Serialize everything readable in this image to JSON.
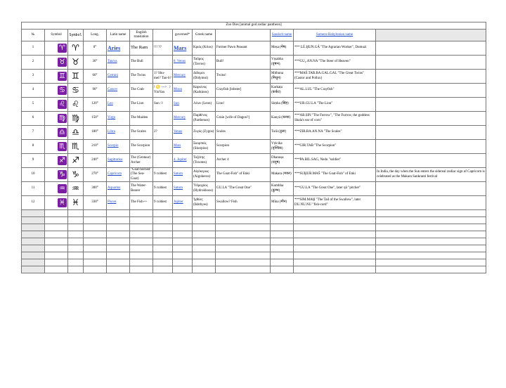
{
  "title": "Zoo Dies [animal god zodiac pantheon]",
  "headers": {
    "n": "№",
    "symbol": "Symbol",
    "symbol2": "Symbol",
    "long": "Long.",
    "latin": "Latin name",
    "english": "English translation",
    "extra": "",
    "governed": "governed*",
    "greek": "Greek name",
    "greek_tr": "",
    "sanskrit": "Sanskrit name",
    "sumero": "Sumero-Babylonian name",
    "notes": ""
  },
  "rows": [
    {
      "n": "1",
      "icon": "♈",
      "sym": "♈",
      "long": "0°",
      "latin": "Aries",
      "en": "The Ram",
      "extra": "!!! ??",
      "gov": "Mars",
      "greek": "Κριός (Krios)",
      "greek_tr": "Former Pawn Peasant",
      "skt": "Meṣa (मेष)",
      "sumer": "*** LÚ.ḪUN.GÁ \"The Agrarian Worker\", Dumuzi",
      "notes": ""
    },
    {
      "n": "2",
      "icon": "♉",
      "sym": "♉",
      "long": "30°",
      "latin": "Taurus",
      "en": "The Bull",
      "extra": "",
      "gov": "8. Venus",
      "greek": "Ταῦρος (Tavros)",
      "greek_tr": "Bull!",
      "skt": "Vṛṣabha (वृषभ)",
      "sumer": "***GU₄.AN.NA \"The Steer of Heaven\"",
      "notes": ""
    },
    {
      "n": "3",
      "icon": "♊",
      "sym": "♊",
      "long": "60°",
      "latin": "Gemini",
      "en": "The Twins",
      "extra": "1? Shu-mei? Tao-b?",
      "gov": "Mercury",
      "greek": "Δίδυμοι (Didymoi)",
      "greek_tr": "Twins!",
      "skt": "Mithuna (मिथुन)",
      "sumer": "***MAŠ.TAB.BA.GAL.GAL \"The Great Twins\" (Castor and Pollux)",
      "notes": ""
    },
    {
      "n": "4",
      "icon": "♋",
      "sym": "♋",
      "long": "90°",
      "latin": "Cancer",
      "en": "The Crab",
      "extra": "! ♋ —> ☽ YinYan",
      "gov": "Moon",
      "greek": "Καρκίνος (Karkinos)",
      "greek_tr": "Crayfish [lobster]",
      "skt": "Karkaṭa (कर्कट)",
      "sumer": "***AL.LUL \"The Crayfish\"",
      "notes": ""
    },
    {
      "n": "5",
      "icon": "♌",
      "sym": "♌",
      "long": "120°",
      "latin": "Leo",
      "en": "The Lion",
      "extra": "Sun ☉",
      "gov": "Sun",
      "greek": "Λέων (Leon)",
      "greek_tr": "Lion!",
      "skt": "Siṃha (सिंह)",
      "sumer": "***UR.GU.LA \"The Lion\"",
      "notes": ""
    },
    {
      "n": "6",
      "icon": "♍",
      "sym": "♍",
      "long": "150°",
      "latin": "Virgo",
      "en": "The Maiden",
      "extra": "",
      "gov": "Mercury",
      "greek": "Παρθένος (Parthenos)",
      "greek_tr": "Grain [wife of Dagon?]",
      "skt": "Kanyā (कन्या)",
      "sumer": "***AB.SIN \"The Furrow\", \"The Furrow, the goddess Shala's ear of corn\"",
      "notes": ""
    },
    {
      "n": "7",
      "icon": "♎",
      "sym": "♎",
      "long": "180°",
      "latin": "Libra",
      "en": "The Scales",
      "extra": "2?",
      "gov": "Venus",
      "greek": "Ζυγός (Zygos)",
      "greek_tr": "Scales",
      "skt": "Tulā (तुला)",
      "sumer": "***ZIB.BA.AN.NA \"The Scales\"",
      "notes": ""
    },
    {
      "n": "8",
      "icon": "♏",
      "sym": "♏",
      "long": "210°",
      "latin": "Scorpio",
      "en": "The Scorpion",
      "extra": "",
      "gov": "Mars",
      "greek": "Σκορπιός (Skorpios)",
      "greek_tr": "Scorpion",
      "skt": "Vṛścika (वृश्चिक)",
      "sumer": "***GIR.TAB \"The Scorpion\"",
      "notes": ""
    },
    {
      "n": "9",
      "icon": "♐",
      "sym": "♐",
      "long": "240°",
      "latin": "Sagittarius",
      "en": "The (Centaur) Archer",
      "extra": "",
      "gov": "4. Jupiter",
      "greek": "Τοξότης (Toxotes)",
      "greek_tr": "Archer 4",
      "skt": "Dhanuṣa (धनुष)",
      "sumer": "***PA.BIL.SAG, Nedu \"soldier\"",
      "notes": ""
    },
    {
      "n": "10",
      "icon": "♑",
      "sym": "♑",
      "long": "270°",
      "latin": "Capricorn",
      "en": "\"Goat-horned\" (The Sea-Goat)",
      "extra": "9 coldest",
      "gov": "Saturn",
      "greek": "Αἰγόκερως (Aigokeros)",
      "greek_tr": "The Goat-Fish\" of Enki",
      "skt": "Makara (मकर)",
      "sumer": "***SUḪUR.MAŠ \"The Goat-Fish\" of Enki",
      "notes": "In India, the day when the Sun enters the sidereal zodiac sign of Capricorn is celebrated as the Makara Sankranti festival"
    },
    {
      "n": "11",
      "icon": "♒",
      "sym": "♒",
      "long": "300°",
      "latin": "Aquarius",
      "en": "The Water-Bearer",
      "extra": "9 coldest",
      "gov": "Saturn",
      "greek": "Ὑδροχόος (Hydrokhoos)",
      "greek_tr": "GU.LA \"The Great One\"",
      "skt": "Kumbha (कुम्भ)",
      "sumer": "***GU.LA \"The Great One\", later qû \"pitcher\"",
      "notes": ""
    },
    {
      "n": "12",
      "icon": "♓",
      "sym": "♓",
      "long": "330°",
      "latin": "Pisces",
      "en": "The Fish++",
      "extra": "9 coldest",
      "gov": "Jupiter",
      "greek": "Ἰχθύες (Ikhthyes)",
      "greek_tr": "Swallow? Fish",
      "skt": "Mīna (मीन)",
      "sumer": "***SIM.MAḪ \"The Tail of the Swallow\", later DU.NU.NU \"fish-cord\"",
      "notes": ""
    }
  ],
  "empty_rows": 9
}
